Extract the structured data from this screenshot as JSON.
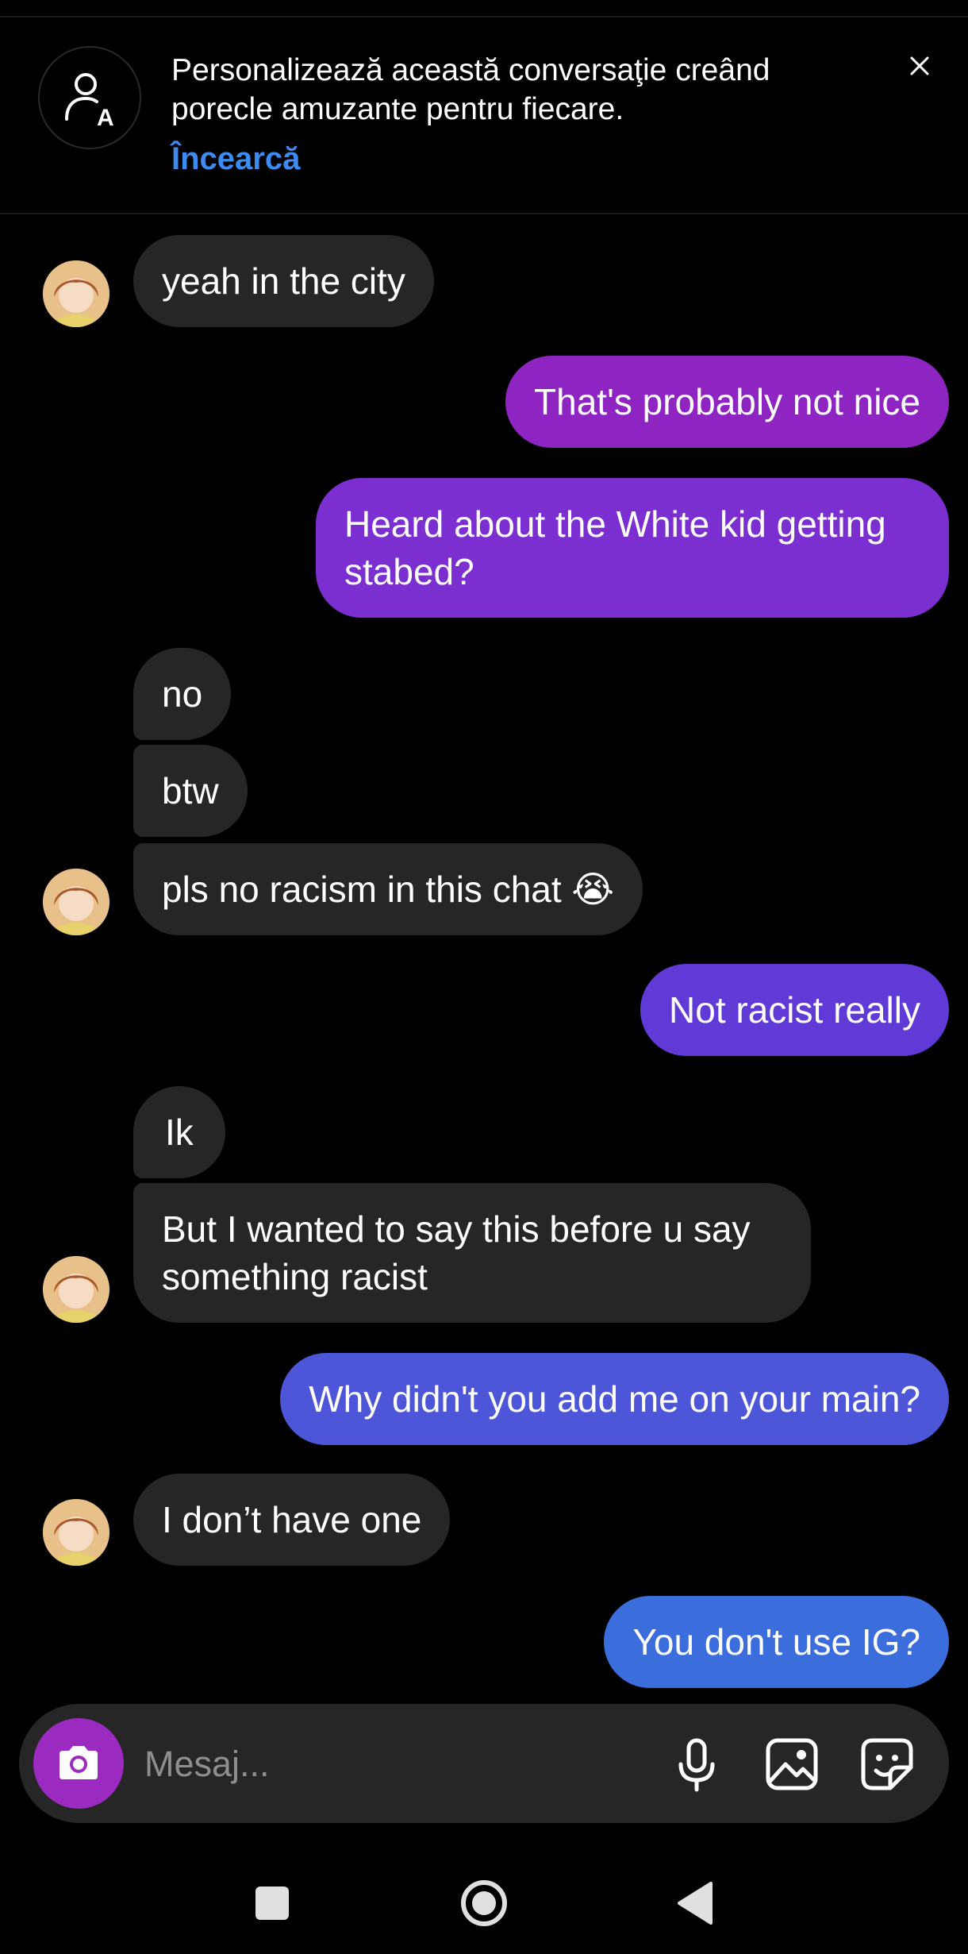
{
  "banner": {
    "text": "Personalizează această conversaţie creând porecle amuzante pentru fiecare.",
    "link": "Încearcă",
    "icon": "person-a-icon",
    "close_icon": "close-icon"
  },
  "messages": [
    {
      "side": "in",
      "text": "yeah in the city"
    },
    {
      "side": "out",
      "text": "That's probably not nice"
    },
    {
      "side": "out",
      "text": "Heard about the White kid getting stabed?"
    },
    {
      "side": "in",
      "text": "no"
    },
    {
      "side": "in",
      "text": "btw"
    },
    {
      "side": "in",
      "text": "pls no racism in this chat 😭"
    },
    {
      "side": "out",
      "text": "Not racist really"
    },
    {
      "side": "in",
      "text": "Ik"
    },
    {
      "side": "in",
      "text": "But I wanted to say this before u say something racist"
    },
    {
      "side": "out",
      "text": "Why didn't you add me on your main?"
    },
    {
      "side": "in",
      "text": "I don’t have one"
    },
    {
      "side": "out",
      "text": "You don't use IG?"
    }
  ],
  "composer": {
    "placeholder": "Mesaj...",
    "icons": [
      "camera-icon",
      "microphone-icon",
      "gallery-icon",
      "sticker-icon"
    ]
  },
  "navbar": {
    "icons": [
      "recents-square-icon",
      "home-circle-icon",
      "back-triangle-icon"
    ]
  },
  "colors": {
    "background": "#000000",
    "incoming_bubble": "#262626",
    "outgoing_gradient": [
      "#8e24c2",
      "#7b2fd0",
      "#5f3ad6",
      "#4d56d8",
      "#3d65db",
      "#3b6edc"
    ],
    "link": "#3d8bf0",
    "camera_button": "#9b2bc0"
  }
}
